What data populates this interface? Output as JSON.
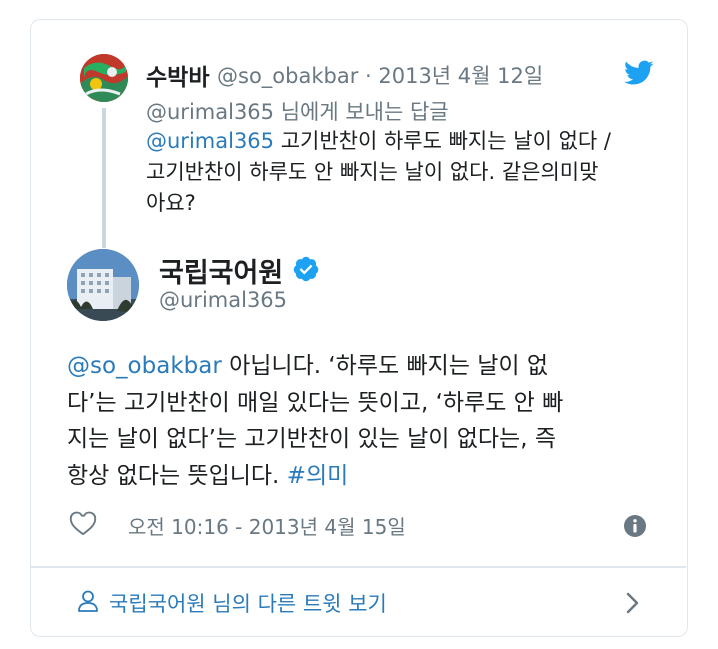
{
  "reply_tweet": {
    "display_name": "수박바",
    "handle_date": "@so_obakbar · 2013년 4월 12일",
    "reply_to": "@urimal365 님에게 보내는 답글",
    "mention": "@urimal365",
    "text_line1": " 고기반찬이 하루도 빠지는 날이 없다 /",
    "text_line2": "고기반찬이 하루도 안 빠지는 날이 없다. 같은의미맞",
    "text_line3": "아요?"
  },
  "main_tweet": {
    "display_name": "국립국어원",
    "handle": "@urimal365",
    "mention": "@so_obakbar",
    "text_line1": " 아닙니다. ‘하루도 빠지는 날이 없",
    "text_line2": "다’는 고기반찬이 매일 있다는 뜻이고, ‘하루도 안 빠",
    "text_line3": "지는 날이 없다’는 고기반찬이 있는 날이 없다는, 즉",
    "text_line4": " 항상 없다는 뜻입니다. ",
    "hashtag": "#의미",
    "timestamp": "오전 10:16 - 2013년 4월 15일"
  },
  "footer": {
    "more_tweets": "국립국어원 님의 다른 트윗 보기"
  },
  "icons": {
    "twitter": "twitter-bird-icon",
    "verified": "verified-badge-icon",
    "like": "heart-icon",
    "info": "info-icon",
    "profile": "person-icon",
    "next": "chevron-right-icon"
  },
  "colors": {
    "link": "#2b7bb9",
    "muted": "#697882",
    "text": "#1c2022",
    "twitter_blue": "#1da1f2",
    "border": "#e1e8ed"
  }
}
